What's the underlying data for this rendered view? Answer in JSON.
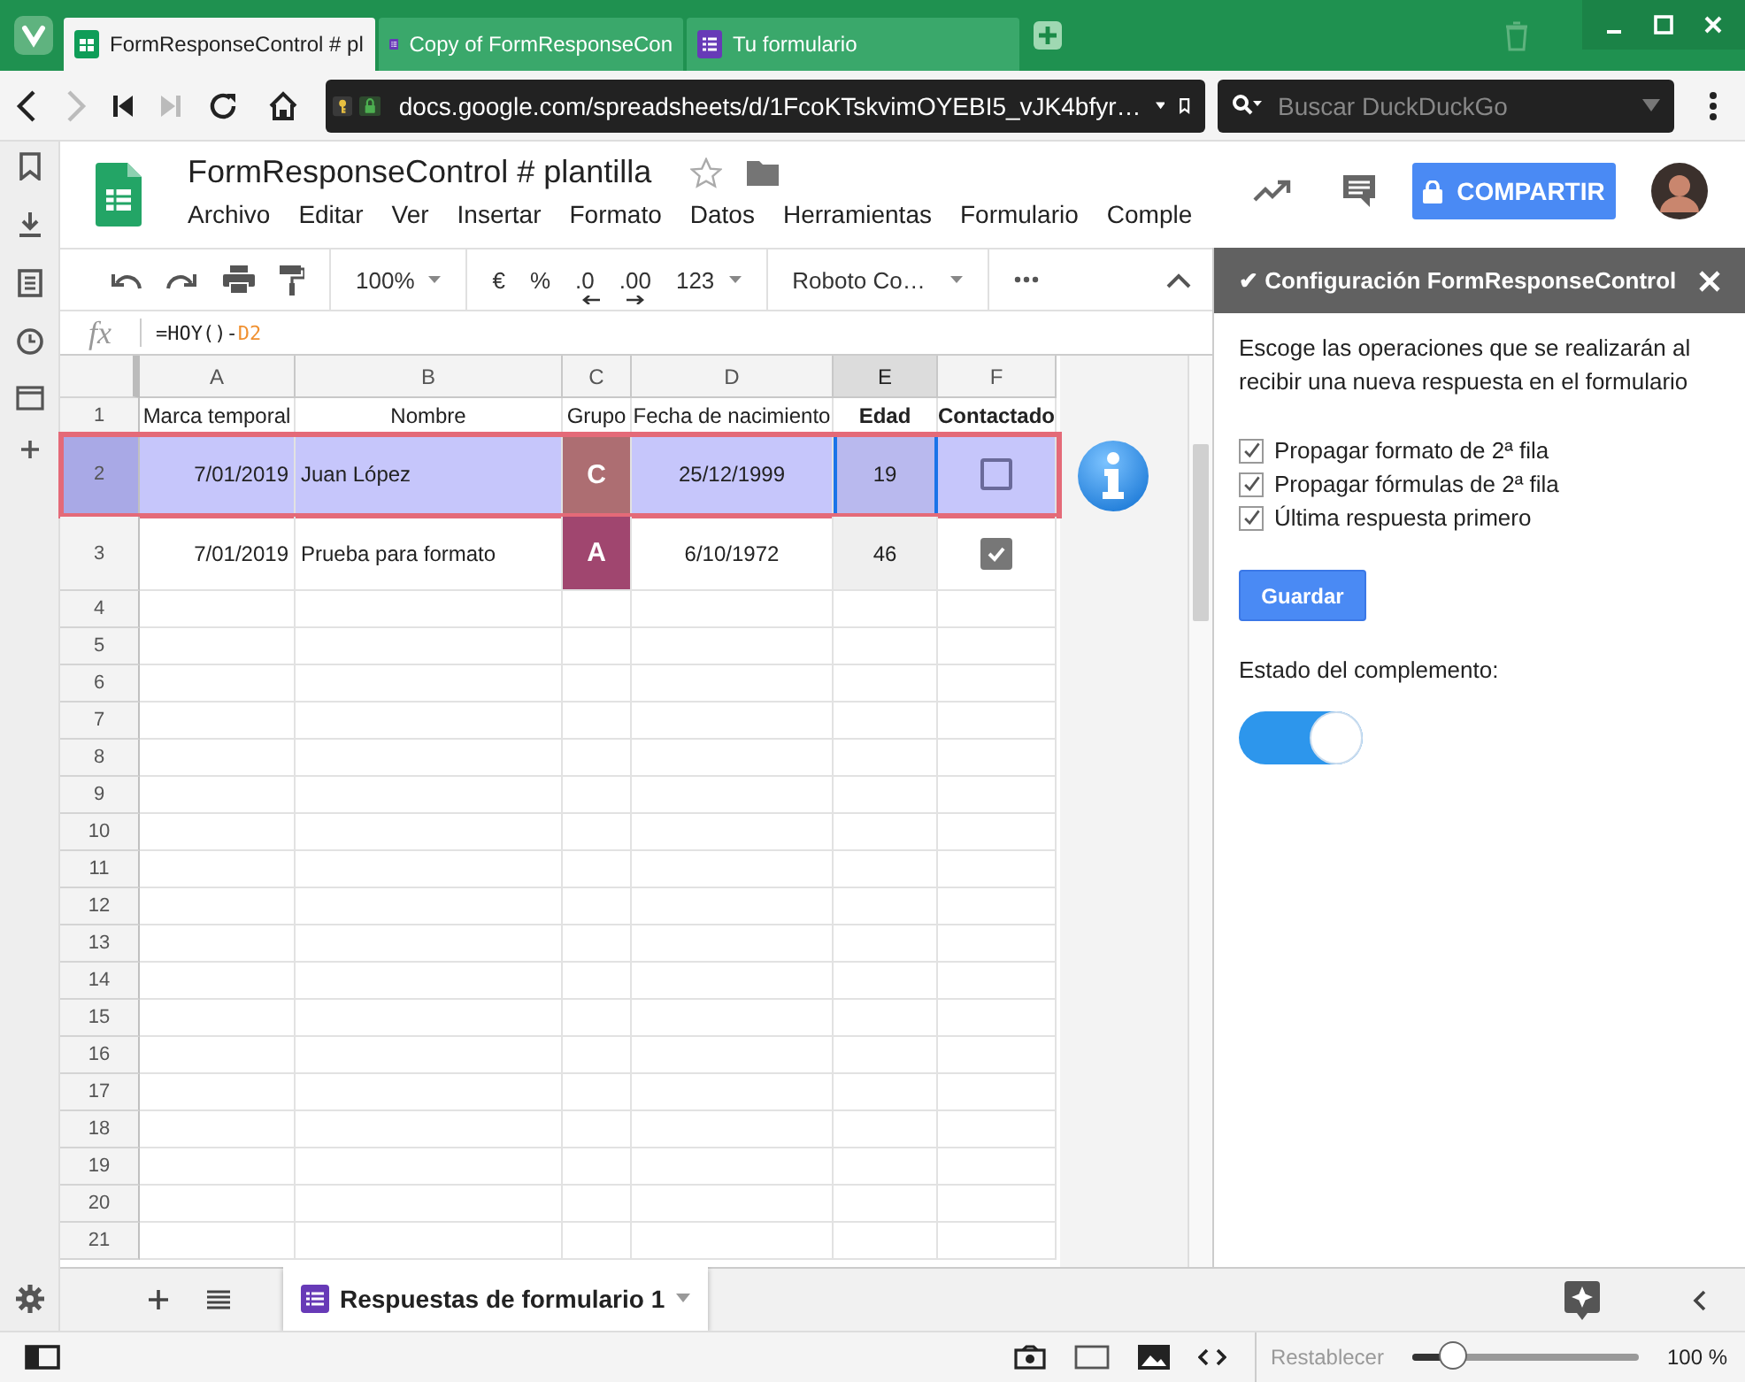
{
  "browser": {
    "tabs": [
      {
        "title": "FormResponseControl # pl",
        "kind": "sheet",
        "selected": true
      },
      {
        "title": "Copy of FormResponseCon",
        "kind": "form",
        "selected": false
      },
      {
        "title": "Tu formulario",
        "kind": "form",
        "selected": false
      }
    ],
    "url": "docs.google.com/spreadsheets/d/1FcoKTskvimOYEBI5_vJK4bfyr…",
    "search": {
      "placeholder": "Buscar DuckDuckGo"
    }
  },
  "document": {
    "title": "FormResponseControl # plantilla",
    "menus": [
      "Archivo",
      "Editar",
      "Ver",
      "Insertar",
      "Formato",
      "Datos",
      "Herramientas",
      "Formulario",
      "Comple"
    ],
    "share_button": "COMPARTIR"
  },
  "toolbar": {
    "zoom": "100%",
    "currency": "€",
    "percent": "%",
    "decrease_decimals": ".0",
    "increase_decimals": ".00",
    "number_format": "123",
    "font": "Roboto Co…"
  },
  "formula_bar": {
    "fx": "fx",
    "formula": "=HOY()-",
    "reference": "D2"
  },
  "sheet": {
    "columns": [
      {
        "label": "A",
        "selected": false
      },
      {
        "label": "B",
        "selected": false
      },
      {
        "label": "C",
        "selected": false
      },
      {
        "label": "D",
        "selected": false
      },
      {
        "label": "E",
        "selected": true
      },
      {
        "label": "F",
        "selected": false
      }
    ],
    "header_row": {
      "number": "1",
      "cells": [
        {
          "text": "Marca temporal",
          "bold": false
        },
        {
          "text": "Nombre",
          "bold": false
        },
        {
          "text": "Grupo",
          "bold": false
        },
        {
          "text": "Fecha de nacimiento",
          "bold": false
        },
        {
          "text": "Edad",
          "bold": true
        },
        {
          "text": "Contactado",
          "bold": true
        }
      ]
    },
    "rows": [
      {
        "number": "2",
        "selected": true,
        "timestamp": "7/01/2019",
        "name": "Juan López",
        "group": {
          "text": "C",
          "color": "#ad6e72"
        },
        "birth_date": "25/12/1999",
        "age": "19",
        "active_cell": true,
        "contacted": false
      },
      {
        "number": "3",
        "selected": false,
        "timestamp": "7/01/2019",
        "name": "Prueba para formato",
        "group": {
          "text": "A",
          "color": "#a0466f"
        },
        "birth_date": "6/10/1972",
        "age": "46",
        "active_cell": false,
        "contacted": true
      }
    ],
    "empty_rows": [
      "4",
      "5",
      "6",
      "7",
      "8",
      "9",
      "10",
      "11",
      "12",
      "13",
      "14",
      "15",
      "16",
      "17",
      "18",
      "19",
      "20",
      "21"
    ]
  },
  "sheet_tabs": [
    {
      "label": "Respuestas de formulario 1",
      "selected": true
    }
  ],
  "panel": {
    "title": "✔ Configuración FormResponseControl",
    "description": "Escoge las operaciones que se realizarán al recibir una nueva respuesta en el formulario",
    "options": [
      {
        "label": "Propagar formato de 2ª fila",
        "checked": true
      },
      {
        "label": "Propagar fórmulas de 2ª fila",
        "checked": true
      },
      {
        "label": "Última respuesta primero",
        "checked": true
      }
    ],
    "save_button": "Guardar",
    "status_label": "Estado del complemento:",
    "enabled": true
  },
  "status_bar": {
    "reset": "Restablecer",
    "zoom": {
      "level": 0.18
    },
    "zoom_reading": "100 %"
  }
}
